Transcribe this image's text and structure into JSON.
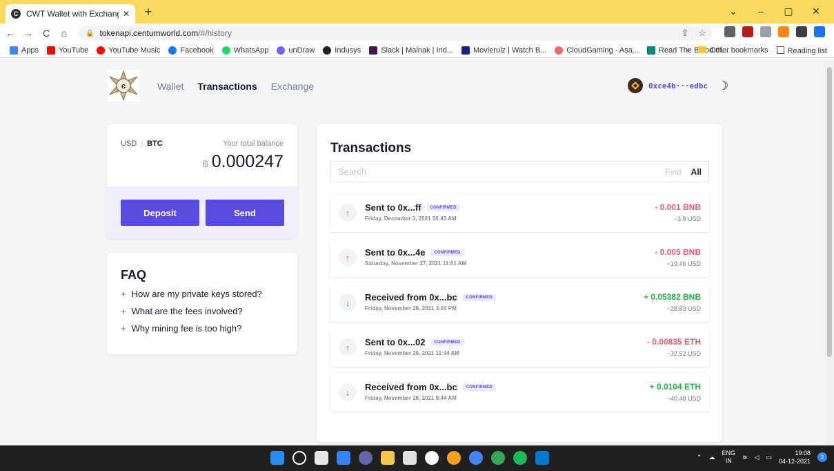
{
  "browser": {
    "tab_title": "CWT Wallet with Exchange",
    "tab_favicon": "C",
    "tab_close": "✕",
    "new_tab": "+",
    "window_controls": [
      "⌄",
      "–",
      "▢",
      "✕"
    ],
    "url_host": "tokenapi.centumworld.com",
    "url_rest": "/#/history",
    "nav": {
      "back": "←",
      "forward": "→",
      "reload": "C",
      "home": "⌂"
    },
    "omni_icons": [
      "⇪",
      "☆"
    ],
    "bookmarks": [
      {
        "label": "Apps",
        "color": "#4285f4"
      },
      {
        "label": "YouTube",
        "color": "#ff0000"
      },
      {
        "label": "YouTube Music",
        "color": "#ff0000"
      },
      {
        "label": "Facebook",
        "color": "#1877f2"
      },
      {
        "label": "WhatsApp",
        "color": "#25d366"
      },
      {
        "label": "unDraw",
        "color": "#6c63ff"
      },
      {
        "label": "Indusys",
        "color": "#222222"
      },
      {
        "label": "Slack | Mainak | Ind...",
        "color": "#4a154b"
      },
      {
        "label": "Movierulz | Watch B...",
        "color": "#1a237e"
      },
      {
        "label": "CloudGaming - Asa...",
        "color": "#f06a6a"
      },
      {
        "label": "Read The Blood of...",
        "color": "#00897b"
      }
    ],
    "bookmarks_more": "»",
    "other_bookmarks": "Other bookmarks",
    "reading_list": "Reading list"
  },
  "header": {
    "nav": [
      {
        "label": "Wallet",
        "active": false
      },
      {
        "label": "Transactions",
        "active": true
      },
      {
        "label": "Exchange",
        "active": false
      }
    ],
    "address": "0xce4b···edbc",
    "moon_icon": "☽"
  },
  "balance": {
    "unit_usd": "USD",
    "unit_btc": "BTC",
    "label": "Your total balance",
    "currency_symbol": "฿",
    "amount": "0.000247",
    "deposit_label": "Deposit",
    "send_label": "Send"
  },
  "faq": {
    "title": "FAQ",
    "items": [
      "How are my private keys stored?",
      "What are the fees involved?",
      "Why mining fee is too high?"
    ]
  },
  "transactions": {
    "title": "Transactions",
    "search_placeholder": "Search",
    "find_label": "Find",
    "all_label": "All",
    "rows": [
      {
        "direction": "up",
        "desc": "Sent to 0x...ff",
        "status": "CONFIRMED",
        "date": "Friday, December 3, 2021 10:43 AM",
        "amount": "- 0.001 BNB",
        "usd": "~3.9 USD"
      },
      {
        "direction": "up",
        "desc": "Sent to 0x...4e",
        "status": "CONFIRMED",
        "date": "Saturday, November 27, 2021 11:01 AM",
        "amount": "- 0.005 BNB",
        "usd": "~19.46 USD"
      },
      {
        "direction": "down",
        "desc": "Received from 0x...bc",
        "status": "CONFIRMED",
        "date": "Friday, November 26, 2021 3:03 PM",
        "amount": "+ 0.05382 BNB",
        "usd": "~28.83 USD"
      },
      {
        "direction": "up",
        "desc": "Sent to 0x...02",
        "status": "CONFIRMED",
        "date": "Friday, November 26, 2021 11:44 AM",
        "amount": "- 0.00835 ETH",
        "usd": "~32.52 USD"
      },
      {
        "direction": "down",
        "desc": "Received from 0x...bc",
        "status": "CONFIRMED",
        "date": "Friday, November 26, 2021 9:44 AM",
        "amount": "+ 0.0104 ETH",
        "usd": "~40.48 USD"
      }
    ]
  },
  "taskbar": {
    "lang_top": "ENG",
    "lang_bottom": "IN",
    "time": "19:08",
    "date": "04-12-2021",
    "notifications": "2"
  },
  "colors": {
    "accent": "#5a4be0",
    "negative": "#ee5c74",
    "positive": "#27b04a",
    "tabbar": "#fbd95f"
  }
}
